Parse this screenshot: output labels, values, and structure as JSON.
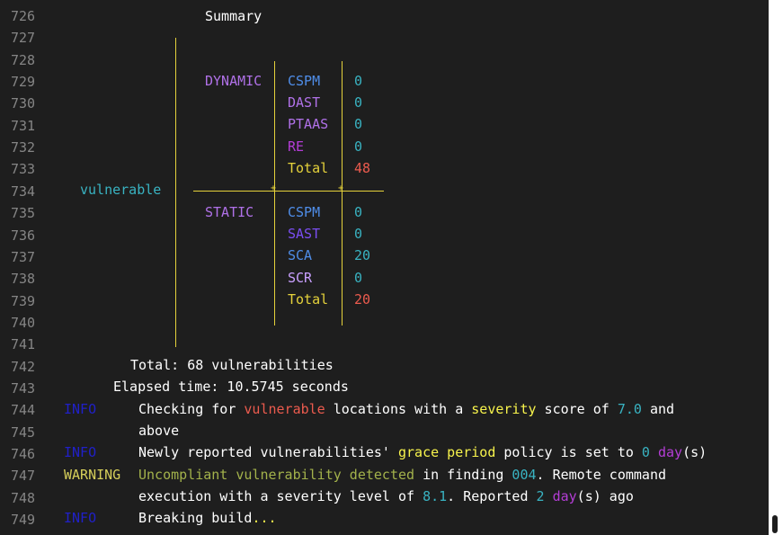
{
  "line_numbers": [
    "726",
    "727",
    "728",
    "729",
    "730",
    "731",
    "732",
    "733",
    "734",
    "735",
    "736",
    "737",
    "738",
    "739",
    "740",
    "741",
    "742",
    "743",
    "744",
    "745",
    "746",
    "747",
    "748",
    "749"
  ],
  "summary_title": "Summary",
  "vulnerable_label": "vulnerable",
  "sections": [
    {
      "label": "DYNAMIC",
      "rows": [
        {
          "name": "CSPM",
          "value": "0"
        },
        {
          "name": "DAST",
          "value": "0"
        },
        {
          "name": "PTAAS",
          "value": "0"
        },
        {
          "name": "RE",
          "value": "0"
        },
        {
          "name": "Total",
          "value": "48"
        }
      ]
    },
    {
      "label": "STATIC",
      "rows": [
        {
          "name": "CSPM",
          "value": "0"
        },
        {
          "name": "SAST",
          "value": "0"
        },
        {
          "name": "SCA",
          "value": "20"
        },
        {
          "name": "SCR",
          "value": "0"
        },
        {
          "name": "Total",
          "value": "20"
        }
      ]
    }
  ],
  "table_pipe": "|",
  "total_line": "Total: 68 vulnerabilities",
  "elapsed_line": "Elapsed time: 10.5745 seconds",
  "log": {
    "info1": {
      "level": "INFO",
      "a": "Checking for ",
      "b": "vulnerable",
      "c": " locations with a ",
      "d": "severity",
      "e": " score of ",
      "f": "7.0",
      "g": " and",
      "cont": "above"
    },
    "info2": {
      "level": "INFO",
      "a": "Newly reported vulnerabilities' ",
      "b": "grace period",
      "c": " policy is set to ",
      "d": "0",
      "e": " ",
      "f": "day",
      "g": "(s)"
    },
    "warning": {
      "level": "WARNING",
      "a": "Uncompliant vulnerability detected",
      "b": " in finding ",
      "c": "004",
      "d": ". Remote command",
      "cont_a": "execution with a severity level of ",
      "cont_b": "8.1",
      "cont_c": ". Reported ",
      "cont_d": "2",
      "cont_e": " ",
      "cont_f": "day",
      "cont_g": "(s) ago"
    },
    "info3": {
      "level": "INFO",
      "a": "Breaking build",
      "b": "..."
    }
  },
  "colors": {
    "background": "#1e1e1e",
    "line_number": "#858585",
    "table_lines": "#e5d23b",
    "dynamic_label": "#b071e8",
    "value_zero": "#39b3c2",
    "total_value": "#ec5b4e",
    "info": "#2020c8",
    "warning": "#d6cf5a"
  }
}
